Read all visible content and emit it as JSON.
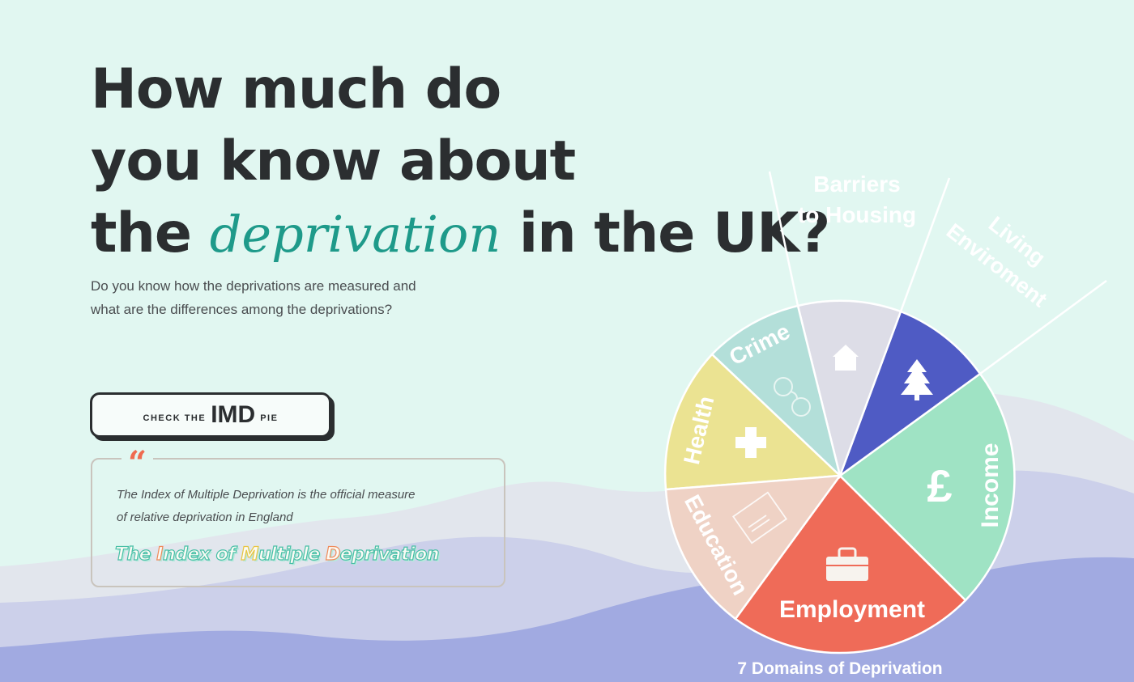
{
  "hero": {
    "title_line1": "How much do",
    "title_line2": "you know about",
    "title_line3_before": "the ",
    "title_highlight": "deprivation",
    "title_line3_after": " in the UK?",
    "subtitle_line1": "Do you know how the deprivations are measured and",
    "subtitle_line2": "what are the differences among the deprivations?"
  },
  "cta": {
    "prefix": "CHECK THE",
    "main": "IMD",
    "suffix": "PIE"
  },
  "quote": {
    "mark": "“",
    "line1": "The Index of Multiple Deprivation is the official measure",
    "line2": "of relative deprivation in England",
    "name_parts": [
      "The ",
      "I",
      "ndex of ",
      "M",
      "ultiple ",
      "D",
      "eprivation"
    ]
  },
  "pie": {
    "caption": "7 Domains of Deprivation",
    "domains": [
      {
        "label": "Employment",
        "icon": "briefcase-icon",
        "color": "#ef6b58"
      },
      {
        "label": "Income",
        "icon": "pound-icon",
        "color": "#9fe3c4"
      },
      {
        "label": "Living Environment",
        "label_line1": "Living",
        "label_line2": "Enviroment",
        "icon": "tree-icon",
        "color": "#4f5bc4"
      },
      {
        "label": "Barriers to Housing",
        "label_line1": "Barriers",
        "label_line2": "to Housing",
        "icon": "house-icon",
        "color": "#dddde7"
      },
      {
        "label": "Crime",
        "icon": "handcuffs-icon",
        "color": "#b3dfd9"
      },
      {
        "label": "Health",
        "icon": "plus-icon",
        "color": "#ebe392"
      },
      {
        "label": "Education",
        "icon": "certificate-icon",
        "color": "#efd2c5"
      }
    ]
  },
  "colors": {
    "background": "#e1f7f1",
    "accent": "#1e9a8a",
    "quote_mark": "#ef6b50",
    "dark": "#2b2e30"
  }
}
